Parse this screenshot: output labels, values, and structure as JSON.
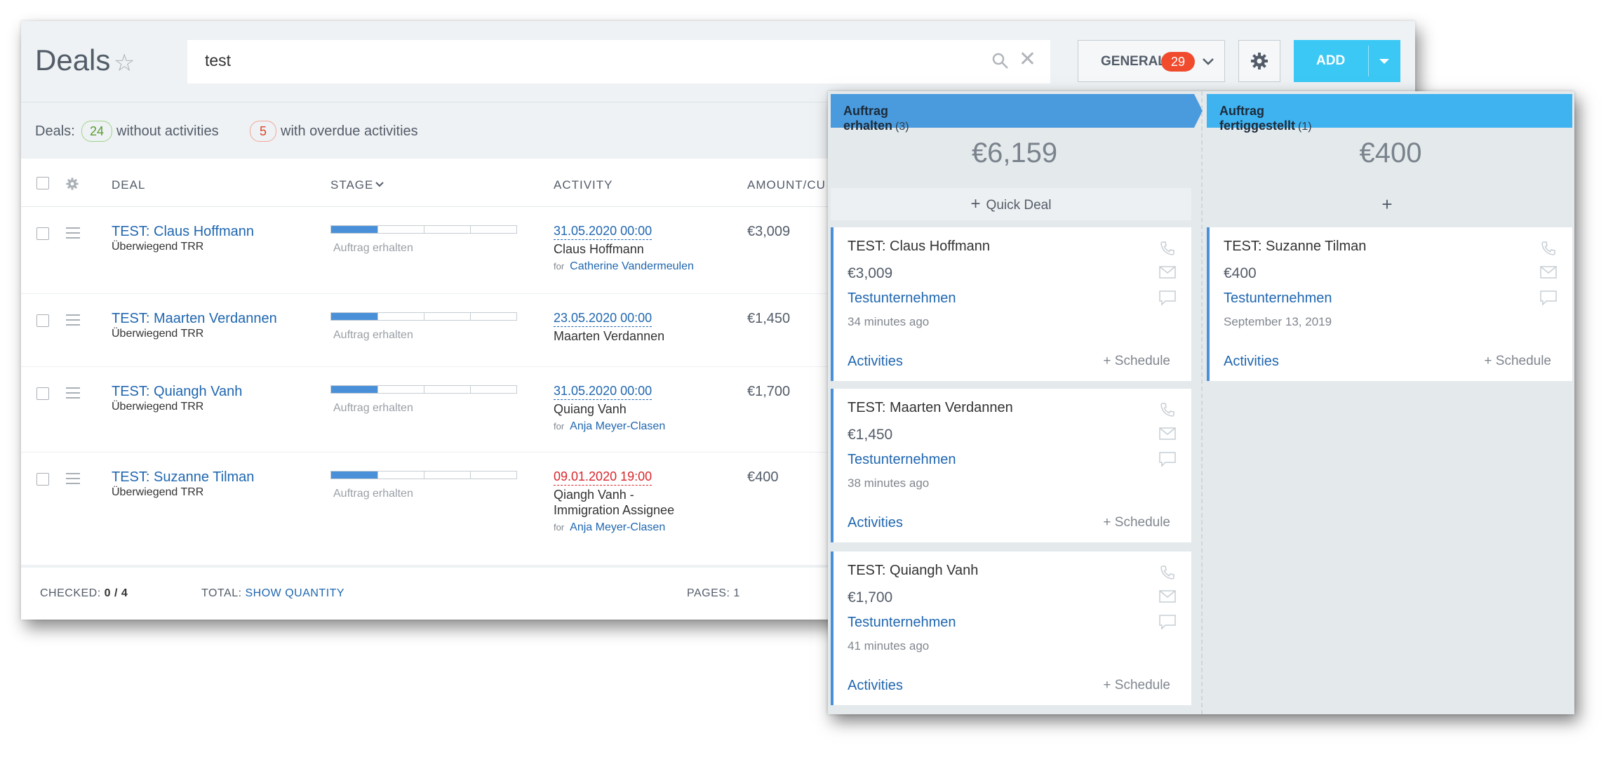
{
  "header": {
    "title": "Deals",
    "search_value": "test",
    "filter_label": "GENERAL",
    "filter_count": "29",
    "add_label": "ADD"
  },
  "info": {
    "prefix": "Deals:",
    "no_activity_count": "24",
    "no_activity_text": "without activities",
    "overdue_count": "5",
    "overdue_text": "with overdue activities"
  },
  "columns": {
    "deal": "DEAL",
    "stage": "STAGE",
    "activity": "ACTIVITY",
    "amount": "AMOUNT/CU"
  },
  "rows": [
    {
      "name": "TEST: Claus Hoffmann",
      "sub": "Überwiegend TRR",
      "stage": "Auftrag erhalten",
      "stage_progress": 0.25,
      "date": "31.05.2020 00:00",
      "overdue": false,
      "contact": "Claus Hoffmann",
      "for_label": "for",
      "for_name": "Catherine Vandermeulen",
      "amount": "€3,009"
    },
    {
      "name": "TEST: Maarten Verdannen",
      "sub": "Überwiegend TRR",
      "stage": "Auftrag erhalten",
      "stage_progress": 0.25,
      "date": "23.05.2020 00:00",
      "overdue": false,
      "contact": "Maarten Verdannen",
      "for_label": "",
      "for_name": "",
      "amount": "€1,450"
    },
    {
      "name": "TEST: Quiangh Vanh",
      "sub": "Überwiegend TRR",
      "stage": "Auftrag erhalten",
      "stage_progress": 0.25,
      "date": "31.05.2020 00:00",
      "overdue": false,
      "contact": "Quiang Vanh",
      "for_label": "for",
      "for_name": "Anja Meyer-Clasen",
      "amount": "€1,700"
    },
    {
      "name": "TEST: Suzanne Tilman",
      "sub": "Überwiegend TRR",
      "stage": "Auftrag erhalten",
      "stage_progress": 0.25,
      "date": "09.01.2020 19:00",
      "overdue": true,
      "contact_line1": "Qiangh Vanh -",
      "contact_line2": "Immigration Assignee",
      "for_label": "for",
      "for_name": "Anja Meyer-Clasen",
      "amount": "€400"
    }
  ],
  "footer": {
    "checked_label": "CHECKED:",
    "checked_value": "0 / 4",
    "total_label": "TOTAL:",
    "total_link": "SHOW QUANTITY",
    "pages_label": "PAGES:",
    "pages_value": "1"
  },
  "kanban": {
    "columns": [
      {
        "name": "Auftrag erhalten",
        "count": "(3)",
        "total": "€6,159",
        "quick_label": "Quick Deal",
        "color": "#4a9bde",
        "cards": [
          {
            "name": "TEST: Claus Hoffmann",
            "amount": "€3,009",
            "company": "Testunternehmen",
            "time": "34 minutes ago",
            "activities": "Activities",
            "schedule": "+ Schedule"
          },
          {
            "name": "TEST: Maarten Verdannen",
            "amount": "€1,450",
            "company": "Testunternehmen",
            "time": "38 minutes ago",
            "activities": "Activities",
            "schedule": "+ Schedule"
          },
          {
            "name": "TEST: Quiangh Vanh",
            "amount": "€1,700",
            "company": "Testunternehmen",
            "time": "41 minutes ago",
            "activities": "Activities",
            "schedule": "+ Schedule"
          }
        ]
      },
      {
        "name": "Auftrag fertiggestellt",
        "count": "(1)",
        "total": "€400",
        "quick_label": "+",
        "color": "#3fb2f0",
        "cards": [
          {
            "name": "TEST: Suzanne Tilman",
            "amount": "€400",
            "company": "Testunternehmen",
            "time": "September 13, 2019",
            "activities": "Activities",
            "schedule": "+ Schedule"
          }
        ]
      }
    ]
  }
}
